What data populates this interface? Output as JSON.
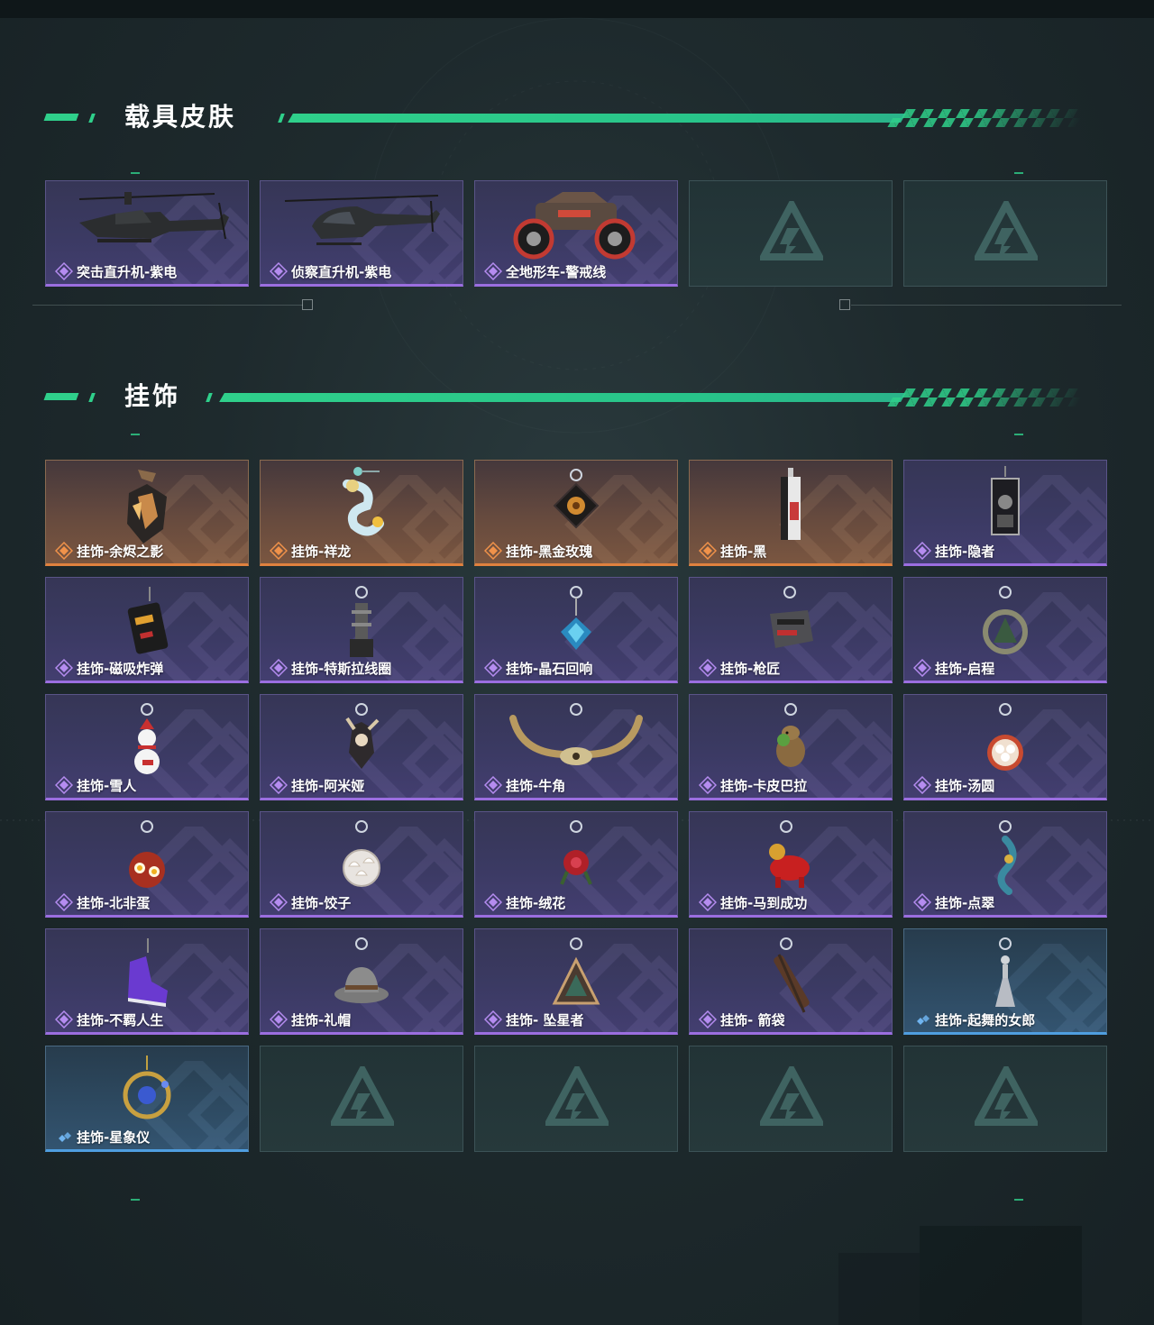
{
  "colors": {
    "accent_green": "#2fd08b",
    "rarity_purple": "#9b6ee0",
    "rarity_orange": "#e0813e",
    "rarity_blue": "#4f9ee0",
    "background": "#1e2a2d"
  },
  "sections": {
    "vehicle": {
      "title": "载具皮肤",
      "items": [
        {
          "label": "突击直升机-紫电",
          "rarity": "purple",
          "icon": "attack-helicopter-icon"
        },
        {
          "label": "侦察直升机-紫电",
          "rarity": "purple",
          "icon": "scout-helicopter-icon"
        },
        {
          "label": "全地形车-警戒线",
          "rarity": "purple",
          "icon": "atv-icon"
        },
        {
          "label": "",
          "rarity": "empty",
          "icon": "empty-slot-logo-icon"
        },
        {
          "label": "",
          "rarity": "empty",
          "icon": "empty-slot-logo-icon"
        }
      ]
    },
    "pendant": {
      "title": "挂饰",
      "items": [
        {
          "label": "挂饰-余烬之影",
          "rarity": "orange",
          "icon": "ember-shadow-charm-icon"
        },
        {
          "label": "挂饰-祥龙",
          "rarity": "orange",
          "icon": "dragon-charm-icon"
        },
        {
          "label": "挂饰-黑金玫瑰",
          "rarity": "orange",
          "icon": "black-gold-rose-charm-icon"
        },
        {
          "label": "挂饰-黑",
          "rarity": "orange",
          "icon": "black-tag-charm-icon"
        },
        {
          "label": "挂饰-隐者",
          "rarity": "purple",
          "icon": "hermit-card-charm-icon"
        },
        {
          "label": "挂饰-磁吸炸弹",
          "rarity": "purple",
          "icon": "magnetic-bomb-charm-icon"
        },
        {
          "label": "挂饰-特斯拉线圈",
          "rarity": "purple",
          "icon": "tesla-coil-charm-icon"
        },
        {
          "label": "挂饰-晶石回响",
          "rarity": "purple",
          "icon": "crystal-echo-charm-icon"
        },
        {
          "label": "挂饰-枪匠",
          "rarity": "purple",
          "icon": "gunsmith-charm-icon"
        },
        {
          "label": "挂饰-启程",
          "rarity": "purple",
          "icon": "departure-charm-icon"
        },
        {
          "label": "挂饰-雪人",
          "rarity": "purple",
          "icon": "snowman-charm-icon"
        },
        {
          "label": "挂饰-阿米娅",
          "rarity": "purple",
          "icon": "amiya-charm-icon"
        },
        {
          "label": "挂饰-牛角",
          "rarity": "purple",
          "icon": "bull-horn-charm-icon"
        },
        {
          "label": "挂饰-卡皮巴拉",
          "rarity": "purple",
          "icon": "capybara-charm-icon"
        },
        {
          "label": "挂饰-汤圆",
          "rarity": "purple",
          "icon": "tangyuan-charm-icon"
        },
        {
          "label": "挂饰-北非蛋",
          "rarity": "purple",
          "icon": "shakshuka-charm-icon"
        },
        {
          "label": "挂饰-饺子",
          "rarity": "purple",
          "icon": "dumpling-charm-icon"
        },
        {
          "label": "挂饰-绒花",
          "rarity": "purple",
          "icon": "velvet-flower-charm-icon"
        },
        {
          "label": "挂饰-马到成功",
          "rarity": "purple",
          "icon": "red-horse-charm-icon"
        },
        {
          "label": "挂饰-点翠",
          "rarity": "purple",
          "icon": "kingfisher-charm-icon"
        },
        {
          "label": "挂饰-不羁人生",
          "rarity": "purple",
          "icon": "sneaker-charm-icon"
        },
        {
          "label": "挂饰-礼帽",
          "rarity": "purple",
          "icon": "fedora-charm-icon"
        },
        {
          "label": "挂饰- 坠星者",
          "rarity": "purple",
          "icon": "triangle-star-charm-icon"
        },
        {
          "label": "挂饰- 箭袋",
          "rarity": "purple",
          "icon": "quiver-charm-icon"
        },
        {
          "label": "挂饰-起舞的女郎",
          "rarity": "blue",
          "icon": "dancing-lady-charm-icon"
        },
        {
          "label": "挂饰-星象仪",
          "rarity": "blue",
          "icon": "astrolabe-charm-icon"
        },
        {
          "label": "",
          "rarity": "empty",
          "icon": "empty-slot-logo-icon"
        },
        {
          "label": "",
          "rarity": "empty",
          "icon": "empty-slot-logo-icon"
        },
        {
          "label": "",
          "rarity": "empty",
          "icon": "empty-slot-logo-icon"
        },
        {
          "label": "",
          "rarity": "empty",
          "icon": "empty-slot-logo-icon"
        }
      ]
    }
  }
}
